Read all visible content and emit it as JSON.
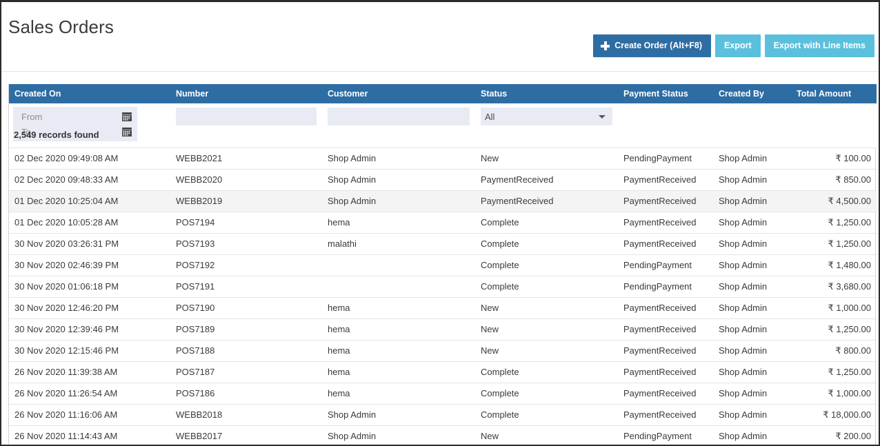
{
  "page": {
    "title": "Sales Orders"
  },
  "toolbar": {
    "create_label": "Create Order (Alt+F8)",
    "export_label": "Export",
    "export_line_items_label": "Export with Line Items",
    "create_color": "#2e6da4",
    "export_color": "#5bc0de",
    "plus_icon": "plus-icon"
  },
  "table": {
    "header_color": "#2d6da4",
    "columns": [
      {
        "key": "created_on",
        "label": "Created On"
      },
      {
        "key": "number",
        "label": "Number"
      },
      {
        "key": "customer",
        "label": "Customer"
      },
      {
        "key": "status",
        "label": "Status"
      },
      {
        "key": "payment_status",
        "label": "Payment Status"
      },
      {
        "key": "created_by",
        "label": "Created By"
      },
      {
        "key": "total_amount",
        "label": "Total Amount"
      }
    ],
    "filters": {
      "date_from_placeholder": "From",
      "date_to_placeholder": "To",
      "calendar_icon": "calendar-icon",
      "number_value": "",
      "number_placeholder": "",
      "customer_value": "",
      "customer_placeholder": "",
      "status_selected": "All",
      "status_options": [
        "All"
      ]
    },
    "records_found": "2,549 records found",
    "rows": [
      {
        "created_on": "02 Dec 2020 09:49:08 AM",
        "number": "WEBB2021",
        "customer": "Shop Admin",
        "status": "New",
        "payment_status": "PendingPayment",
        "created_by": "Shop Admin",
        "total_amount": "₹ 100.00",
        "highlighted": false
      },
      {
        "created_on": "02 Dec 2020 09:48:33 AM",
        "number": "WEBB2020",
        "customer": "Shop Admin",
        "status": "PaymentReceived",
        "payment_status": "PaymentReceived",
        "created_by": "Shop Admin",
        "total_amount": "₹ 850.00",
        "highlighted": false
      },
      {
        "created_on": "01 Dec 2020 10:25:04 AM",
        "number": "WEBB2019",
        "customer": "Shop Admin",
        "status": "PaymentReceived",
        "payment_status": "PaymentReceived",
        "created_by": "Shop Admin",
        "total_amount": "₹ 4,500.00",
        "highlighted": true
      },
      {
        "created_on": "01 Dec 2020 10:05:28 AM",
        "number": "POS7194",
        "customer": "hema",
        "status": "Complete",
        "payment_status": "PaymentReceived",
        "created_by": "Shop Admin",
        "total_amount": "₹ 1,250.00",
        "highlighted": false
      },
      {
        "created_on": "30 Nov 2020 03:26:31 PM",
        "number": "POS7193",
        "customer": "malathi",
        "status": "Complete",
        "payment_status": "PaymentReceived",
        "created_by": "Shop Admin",
        "total_amount": "₹ 1,250.00",
        "highlighted": false
      },
      {
        "created_on": "30 Nov 2020 02:46:39 PM",
        "number": "POS7192",
        "customer": "",
        "status": "Complete",
        "payment_status": "PendingPayment",
        "created_by": "Shop Admin",
        "total_amount": "₹ 1,480.00",
        "highlighted": false
      },
      {
        "created_on": "30 Nov 2020 01:06:18 PM",
        "number": "POS7191",
        "customer": "",
        "status": "Complete",
        "payment_status": "PendingPayment",
        "created_by": "Shop Admin",
        "total_amount": "₹ 3,680.00",
        "highlighted": false
      },
      {
        "created_on": "30 Nov 2020 12:46:20 PM",
        "number": "POS7190",
        "customer": "hema",
        "status": "New",
        "payment_status": "PaymentReceived",
        "created_by": "Shop Admin",
        "total_amount": "₹ 1,000.00",
        "highlighted": false
      },
      {
        "created_on": "30 Nov 2020 12:39:46 PM",
        "number": "POS7189",
        "customer": "hema",
        "status": "New",
        "payment_status": "PaymentReceived",
        "created_by": "Shop Admin",
        "total_amount": "₹ 1,250.00",
        "highlighted": false
      },
      {
        "created_on": "30 Nov 2020 12:15:46 PM",
        "number": "POS7188",
        "customer": "hema",
        "status": "New",
        "payment_status": "PaymentReceived",
        "created_by": "Shop Admin",
        "total_amount": "₹ 800.00",
        "highlighted": false
      },
      {
        "created_on": "26 Nov 2020 11:39:38 AM",
        "number": "POS7187",
        "customer": "hema",
        "status": "Complete",
        "payment_status": "PaymentReceived",
        "created_by": "Shop Admin",
        "total_amount": "₹ 1,250.00",
        "highlighted": false
      },
      {
        "created_on": "26 Nov 2020 11:26:54 AM",
        "number": "POS7186",
        "customer": "hema",
        "status": "Complete",
        "payment_status": "PaymentReceived",
        "created_by": "Shop Admin",
        "total_amount": "₹ 1,000.00",
        "highlighted": false
      },
      {
        "created_on": "26 Nov 2020 11:16:06 AM",
        "number": "WEBB2018",
        "customer": "Shop Admin",
        "status": "Complete",
        "payment_status": "PaymentReceived",
        "created_by": "Shop Admin",
        "total_amount": "₹ 18,000.00",
        "highlighted": false
      },
      {
        "created_on": "26 Nov 2020 11:14:43 AM",
        "number": "WEBB2017",
        "customer": "Shop Admin",
        "status": "New",
        "payment_status": "PendingPayment",
        "created_by": "Shop Admin",
        "total_amount": "₹ 200.00",
        "highlighted": false
      }
    ]
  }
}
